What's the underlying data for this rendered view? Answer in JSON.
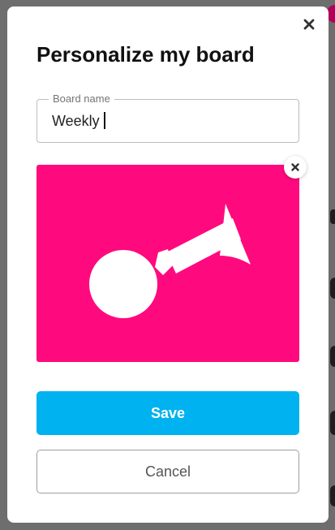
{
  "dialog": {
    "title": "Personalize my board",
    "close_icon": "close-icon",
    "board_name": {
      "label": "Board name",
      "value": "Weekly"
    },
    "image": {
      "icon": "bulb-horn-icon",
      "background_color": "#ff0a7e",
      "remove_icon": "close-icon"
    },
    "save_label": "Save",
    "cancel_label": "Cancel"
  },
  "colors": {
    "accent": "#00b2ef",
    "image_background": "#ff0a7e"
  }
}
